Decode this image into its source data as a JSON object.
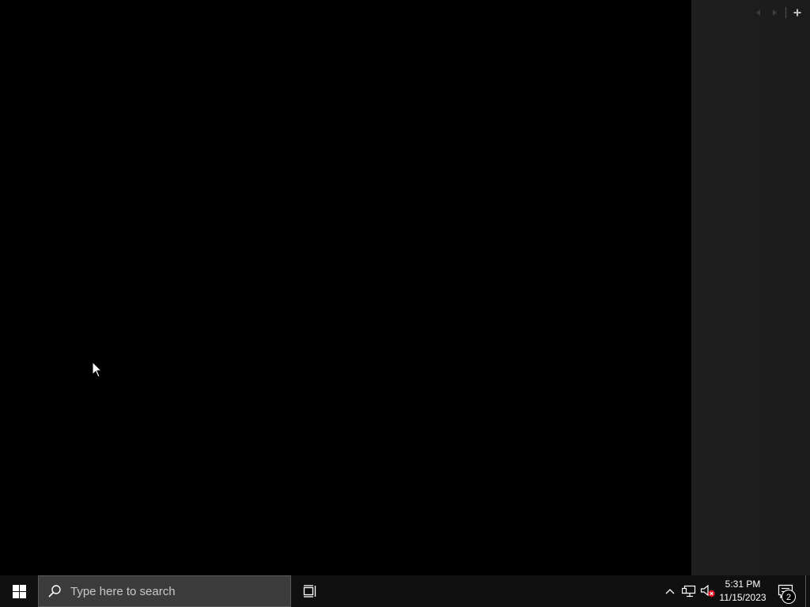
{
  "taskbar": {
    "search": {
      "placeholder": "Type here to search"
    },
    "clock": {
      "time": "5:31 PM",
      "date": "11/15/2023"
    },
    "notifications": {
      "count": "2"
    }
  },
  "side_panel": {
    "controls": [
      "previous",
      "next",
      "add"
    ]
  },
  "colors": {
    "desktop": "#000000",
    "taskbar": "#101010",
    "side_panel": "#1e1e1e",
    "search_box": "#3c3c3c",
    "volume_muted_badge": "#e81123"
  },
  "icons": {
    "start": "windows-logo-icon",
    "search": "magnifier-icon",
    "task_view": "task-view-icon",
    "tray_overflow": "chevron-up-icon",
    "network": "network-icon",
    "volume": "volume-muted-icon",
    "action_center": "action-center-icon"
  }
}
